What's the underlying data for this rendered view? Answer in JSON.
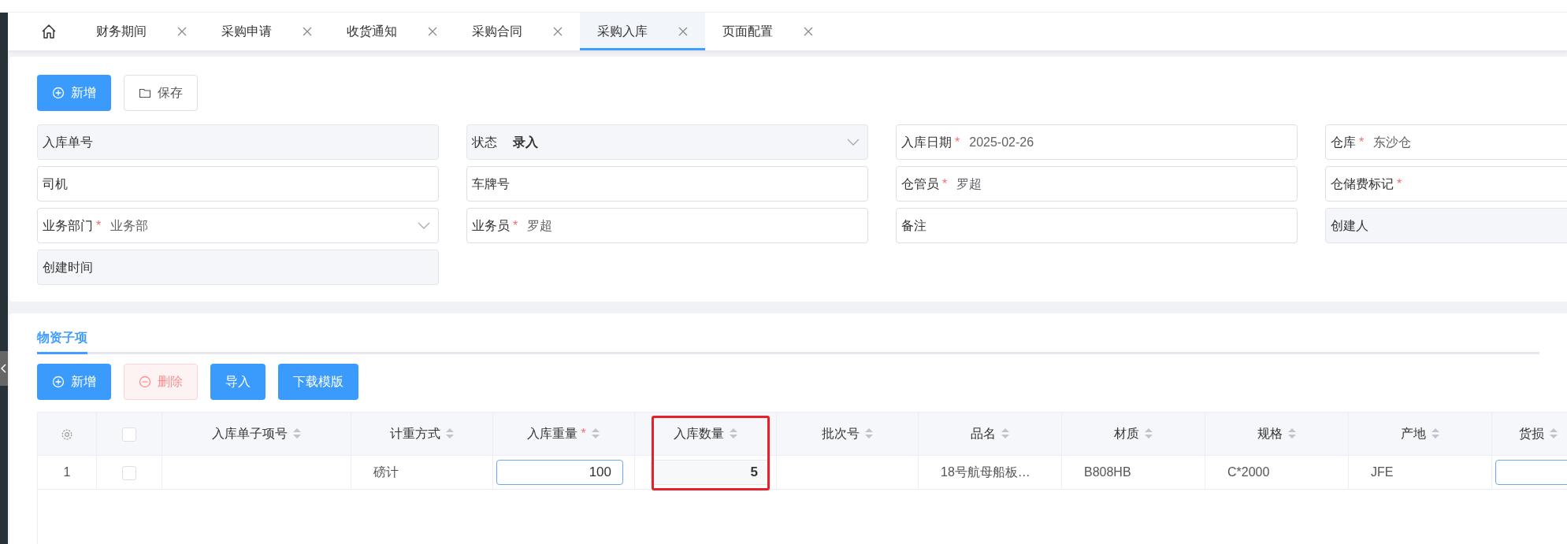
{
  "tabs": [
    {
      "label": "财务期间",
      "selected": false
    },
    {
      "label": "采购申请",
      "selected": false
    },
    {
      "label": "收货通知",
      "selected": false
    },
    {
      "label": "采购合同",
      "selected": false
    },
    {
      "label": "采购入库",
      "selected": true
    },
    {
      "label": "页面配置",
      "selected": false
    }
  ],
  "toolbar": [
    {
      "label": "新增",
      "kind": "add",
      "disabled": false
    },
    {
      "label": "保存",
      "kind": "save",
      "disabled": false
    }
  ],
  "fields": [
    {
      "label": "入库单号",
      "kind": "readonly-text"
    },
    {
      "label": "状态",
      "kind": "readonly-select",
      "value": "录入",
      "strong": true
    },
    {
      "label": "入库日期",
      "required_mark": "*",
      "kind": "text",
      "value": "2025-02-26",
      "strong": false
    },
    {
      "label": "仓库",
      "required_mark": "*",
      "kind": "text",
      "value": "东沙仓",
      "strong": false
    },
    {
      "label": "司机",
      "kind": "text"
    },
    {
      "label": "车牌号",
      "kind": "text"
    },
    {
      "label": "仓管员",
      "required_mark": "*",
      "kind": "text",
      "value": "罗超",
      "strong": false
    },
    {
      "label": "仓储费标记",
      "required_mark": "*",
      "kind": "text"
    },
    {
      "label": "业务部门",
      "required_mark": "*",
      "kind": "select",
      "value": "业务部",
      "strong": false
    },
    {
      "label": "业务员",
      "required_mark": "*",
      "kind": "text",
      "value": "罗超",
      "strong": false
    },
    {
      "label": "备注",
      "kind": "text"
    },
    {
      "label": "创建人",
      "kind": "readonly-text"
    },
    {
      "label": "创建时间",
      "kind": "readonly-text"
    }
  ],
  "section": {
    "tabs": [
      {
        "label": "物资子项",
        "selected": true
      }
    ],
    "buttons": [
      {
        "label": "新增",
        "kind": "add",
        "disabled": false
      },
      {
        "label": "删除",
        "kind": "delete",
        "disabled": true
      },
      {
        "label": "导入",
        "kind": "plain",
        "disabled": false
      },
      {
        "label": "下载模版",
        "kind": "plain",
        "disabled": false
      }
    ],
    "table": {
      "columns": [
        {
          "kind": "settings"
        },
        {
          "kind": "checkbox",
          "checked": false
        },
        {
          "kind": "sort",
          "label": "入库单子项号",
          "highlighted": false
        },
        {
          "kind": "sort",
          "label": "计重方式",
          "highlighted": false
        },
        {
          "kind": "sort",
          "label": "入库重量",
          "required_mark": "*",
          "highlighted": false
        },
        {
          "kind": "sort",
          "label": "入库数量",
          "highlighted": true
        },
        {
          "kind": "sort",
          "label": "批次号",
          "highlighted": false
        },
        {
          "kind": "sort",
          "label": "品名",
          "highlighted": false
        },
        {
          "kind": "sort",
          "label": "材质",
          "highlighted": false
        },
        {
          "kind": "sort",
          "label": "规格",
          "highlighted": false
        },
        {
          "kind": "sort",
          "label": "产地",
          "highlighted": false
        },
        {
          "kind": "sort",
          "label": "货损",
          "highlighted": false
        }
      ],
      "rows": [
        {
          "cells": [
            {
              "kind": "index",
              "text": "1"
            },
            {
              "kind": "checkbox",
              "checked": false
            },
            {
              "kind": "text"
            },
            {
              "kind": "text",
              "text": "磅计"
            },
            {
              "kind": "input",
              "value": "100"
            },
            {
              "kind": "readonly",
              "value": "5"
            },
            {
              "kind": "text"
            },
            {
              "kind": "text",
              "text": "18号航母船板…"
            },
            {
              "kind": "text",
              "text": "B808HB"
            },
            {
              "kind": "text",
              "text": "C*2000"
            },
            {
              "kind": "text",
              "text": "JFE"
            },
            {
              "kind": "input"
            }
          ]
        }
      ]
    }
  }
}
